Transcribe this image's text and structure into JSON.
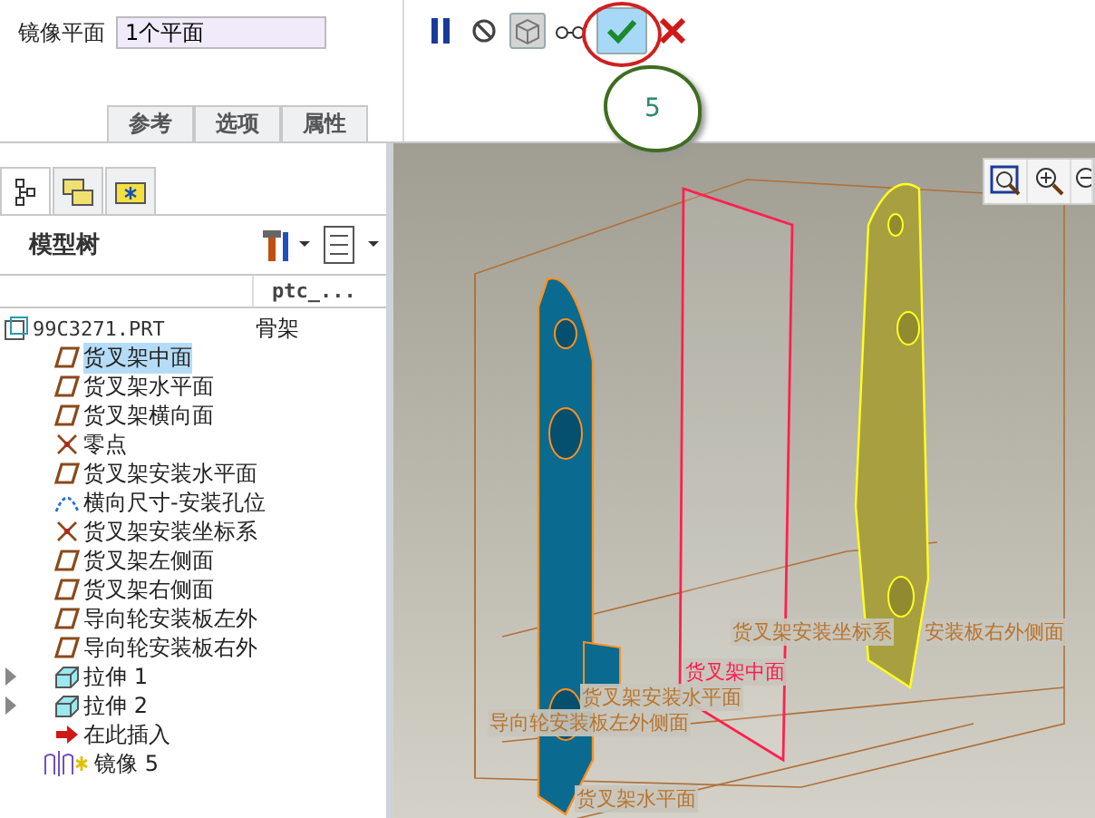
{
  "dashboard": {
    "field_label": "镜像平面",
    "field_value": "1个平面",
    "tabs": [
      {
        "label": "参考",
        "selected": false
      },
      {
        "label": "选项",
        "selected": false
      },
      {
        "label": "属性",
        "selected": false
      }
    ]
  },
  "toolbar": [
    {
      "kind": "pause",
      "selected": false
    },
    {
      "kind": "stop",
      "selected": false
    },
    {
      "kind": "preview",
      "selected": true
    },
    {
      "kind": "glasses",
      "selected": false
    },
    {
      "kind": "ok",
      "selected": true
    },
    {
      "kind": "cancel",
      "selected": false
    }
  ],
  "callout": {
    "text": "5"
  },
  "navigator": {
    "tabs": [
      {
        "kind": "tree",
        "selected": true
      },
      {
        "kind": "folders",
        "selected": false
      },
      {
        "kind": "favorites",
        "selected": false
      }
    ],
    "title": "模型树",
    "column": "ptc_...",
    "root": {
      "label": "99C3271.PRT",
      "value": "骨架",
      "children": [
        {
          "kind": "plane",
          "label": "货叉架中面",
          "selected": true
        },
        {
          "kind": "plane",
          "label": "货叉架水平面",
          "selected": false
        },
        {
          "kind": "plane",
          "label": "货叉架横向面",
          "selected": false
        },
        {
          "kind": "csys",
          "label": "零点",
          "selected": false
        },
        {
          "kind": "plane",
          "label": "货叉架安装水平面",
          "selected": false
        },
        {
          "kind": "curve",
          "label": "横向尺寸-安装孔位",
          "selected": false
        },
        {
          "kind": "csys",
          "label": "货叉架安装坐标系",
          "selected": false
        },
        {
          "kind": "plane",
          "label": "货叉架左侧面",
          "selected": false
        },
        {
          "kind": "plane",
          "label": "货叉架右侧面",
          "selected": false
        },
        {
          "kind": "plane",
          "label": "导向轮安装板左外",
          "selected": false
        },
        {
          "kind": "plane",
          "label": "导向轮安装板右外",
          "selected": false
        },
        {
          "kind": "extrude",
          "label": "拉伸 1",
          "selected": false,
          "expanded": false
        },
        {
          "kind": "extrude",
          "label": "拉伸 2",
          "selected": false,
          "expanded": false
        },
        {
          "kind": "insert",
          "label": "在此插入",
          "selected": false
        },
        {
          "kind": "mirror",
          "label": "镜像 5",
          "selected": false
        }
      ]
    }
  },
  "viewport": {
    "labels": [
      {
        "text": "货叉架安装坐标系",
        "color": "#b8742e"
      },
      {
        "text": "安装板右外侧面",
        "color": "#b8742e"
      },
      {
        "text": "货叉架中面",
        "color": "#ff1a4a"
      },
      {
        "text": "货叉架安装水平面",
        "color": "#b8742e"
      },
      {
        "text": "导向轮安装板左外侧面",
        "color": "#b8742e"
      },
      {
        "text": "货叉架水平面",
        "color": "#b8742e"
      }
    ]
  }
}
